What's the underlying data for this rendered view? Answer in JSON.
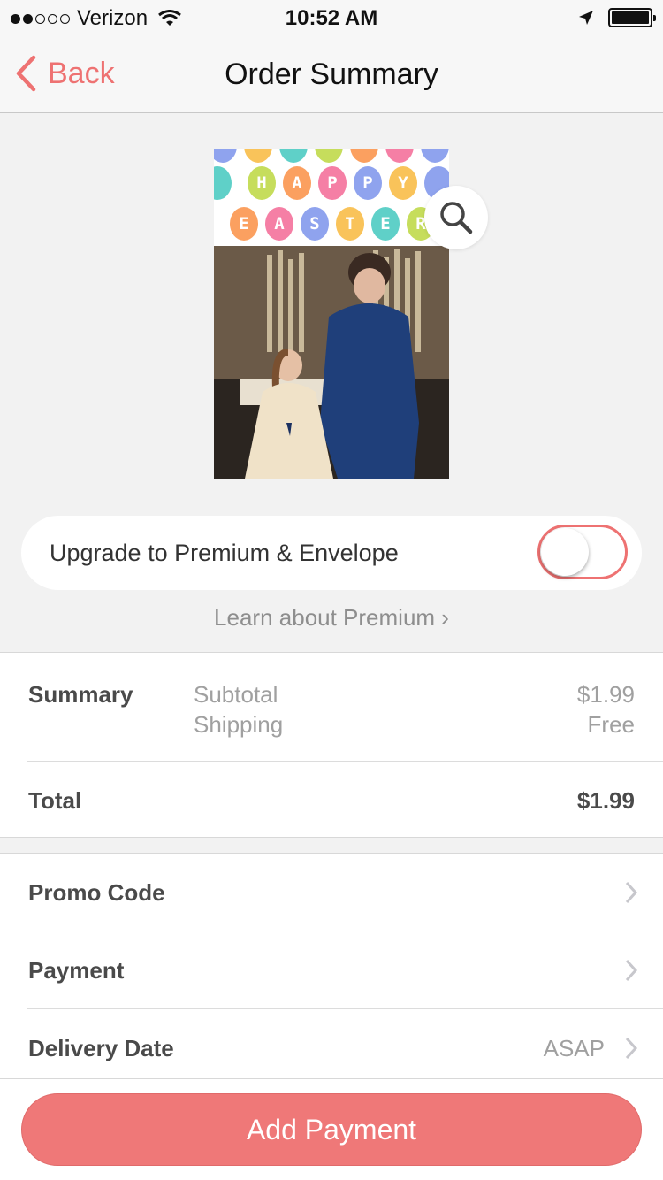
{
  "status_bar": {
    "carrier": "Verizon",
    "time": "10:52 AM",
    "signal_bars_filled": 2,
    "signal_bars_total": 5,
    "battery_level": 1.0
  },
  "nav": {
    "back_label": "Back",
    "title": "Order Summary"
  },
  "card": {
    "eggs_row1": [
      "H",
      "A",
      "P",
      "P",
      "Y"
    ],
    "eggs_row2": [
      "E",
      "A",
      "S",
      "T",
      "E",
      "R"
    ]
  },
  "upgrade": {
    "label": "Upgrade to Premium & Envelope",
    "enabled": false
  },
  "learn_link": "Learn about Premium ›",
  "summary": {
    "title": "Summary",
    "lines": [
      {
        "label": "Subtotal",
        "value": "$1.99"
      },
      {
        "label": "Shipping",
        "value": "Free"
      }
    ],
    "total_label": "Total",
    "total_value": "$1.99"
  },
  "options": [
    {
      "label": "Promo Code",
      "value": ""
    },
    {
      "label": "Payment",
      "value": ""
    },
    {
      "label": "Delivery Date",
      "value": "ASAP"
    }
  ],
  "primary_button": "Add Payment",
  "colors": {
    "accent": "#ee7272",
    "button": "#ef7878",
    "background": "#f2f2f2"
  }
}
